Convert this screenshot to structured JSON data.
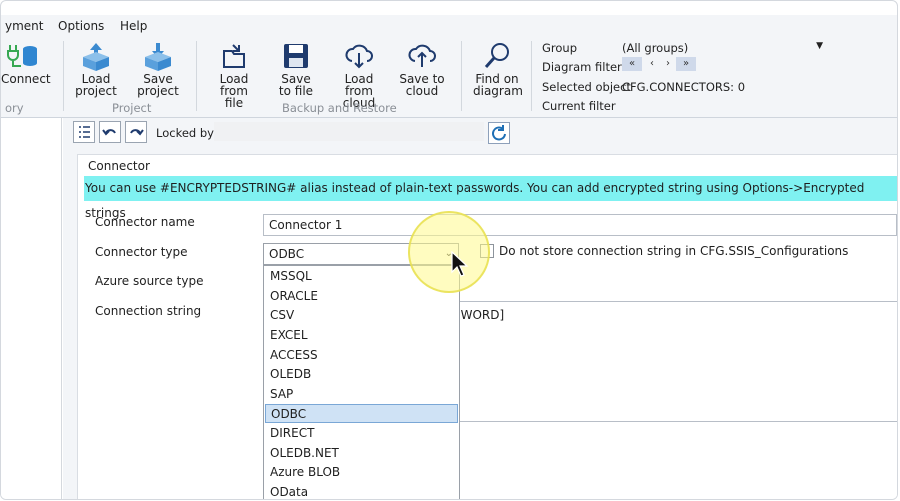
{
  "menu": {
    "items": [
      "yment",
      "Options",
      "Help"
    ]
  },
  "ribbon": {
    "connect_label": "Connect",
    "group_partial": "ory",
    "load_project": [
      "Load",
      "project"
    ],
    "save_project": [
      "Save",
      "project"
    ],
    "project_group": "Project",
    "load_file": [
      "Load from",
      "file"
    ],
    "save_file": [
      "Save",
      "to file"
    ],
    "load_cloud": [
      "Load from",
      "cloud"
    ],
    "save_cloud": [
      "Save to",
      "cloud"
    ],
    "backup_group": "Backup and Restore",
    "find_diagram": [
      "Find on",
      "diagram"
    ],
    "group_label": "Group",
    "group_value": "(All groups)",
    "diagram_filter_label": "Diagram filter",
    "filter_buttons": [
      "«",
      "‹",
      "›",
      "»"
    ],
    "selected_object_label": "Selected object",
    "selected_object_value": "CFG.CONNECTORS: 0",
    "current_filter_label": "Current filter"
  },
  "toolbar": {
    "locked_by": "Locked by"
  },
  "form": {
    "section_title": "Connector",
    "banner": "You can use #ENCRYPTEDSTRING# alias instead of plain-text passwords. You can add encrypted string using Options->Encrypted strings",
    "name_label": "Connector name",
    "name_value": "Connector 1",
    "type_label": "Connector type",
    "type_value": "ODBC",
    "no_store_label": "Do not store connection string in CFG.SSIS_Configurations",
    "azure_label": "Azure source type",
    "connstr_label": "Connection string",
    "connstr_partial": "SWORD]"
  },
  "dropdown": {
    "options": [
      "MSSQL",
      "ORACLE",
      "CSV",
      "EXCEL",
      "ACCESS",
      "OLEDB",
      "SAP",
      "ODBC",
      "DIRECT",
      "OLEDB.NET",
      "Azure BLOB",
      "OData"
    ],
    "selected": "ODBC"
  },
  "icons": {
    "connect": "plug-database-icon",
    "load_project": "cloud-download-box-icon",
    "save_project": "cloud-upload-box-icon",
    "load_file": "folder-open-icon",
    "save_file": "floppy-disk-icon",
    "load_cloud": "cloud-download-icon",
    "save_cloud": "cloud-upload-icon",
    "find": "magnifier-icon"
  },
  "colors": {
    "banner": "#7ff1f1",
    "selection": "#cfe2f5",
    "ribbon": "#f3f5f8",
    "accent": "#1e6fb5"
  }
}
